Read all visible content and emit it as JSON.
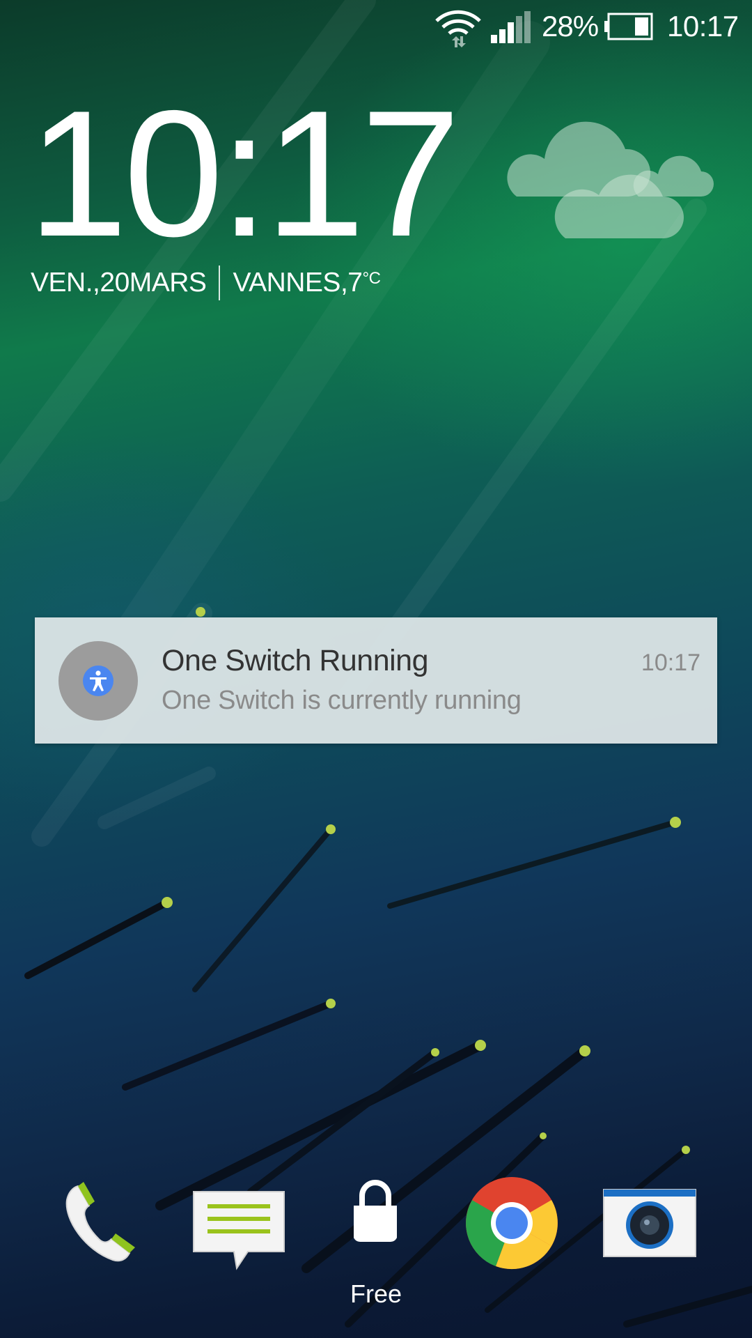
{
  "status_bar": {
    "battery_percent": "28%",
    "time": "10:17",
    "icons": [
      "wifi-icon",
      "signal-icon",
      "battery-icon"
    ]
  },
  "lockscreen": {
    "clock": "10:17",
    "date_day": "VEN., ",
    "date_num": "20",
    "date_month": " MARS",
    "location": "VANNES, ",
    "temperature": "7",
    "temp_unit": "°C",
    "weather_icon": "cloudy-icon"
  },
  "notification": {
    "icon": "accessibility-icon",
    "title": "One Switch Running",
    "text": "One Switch is currently running",
    "time": "10:17"
  },
  "dock": {
    "items": [
      {
        "icon": "phone-icon"
      },
      {
        "icon": "messages-icon"
      },
      {
        "icon": "lock-icon",
        "label": "Free"
      },
      {
        "icon": "chrome-icon"
      },
      {
        "icon": "camera-icon"
      }
    ]
  },
  "colors": {
    "notification_bg": "#e1e8ea",
    "accent_green": "#9ac31c",
    "accessibility_blue": "#4a86f0"
  }
}
